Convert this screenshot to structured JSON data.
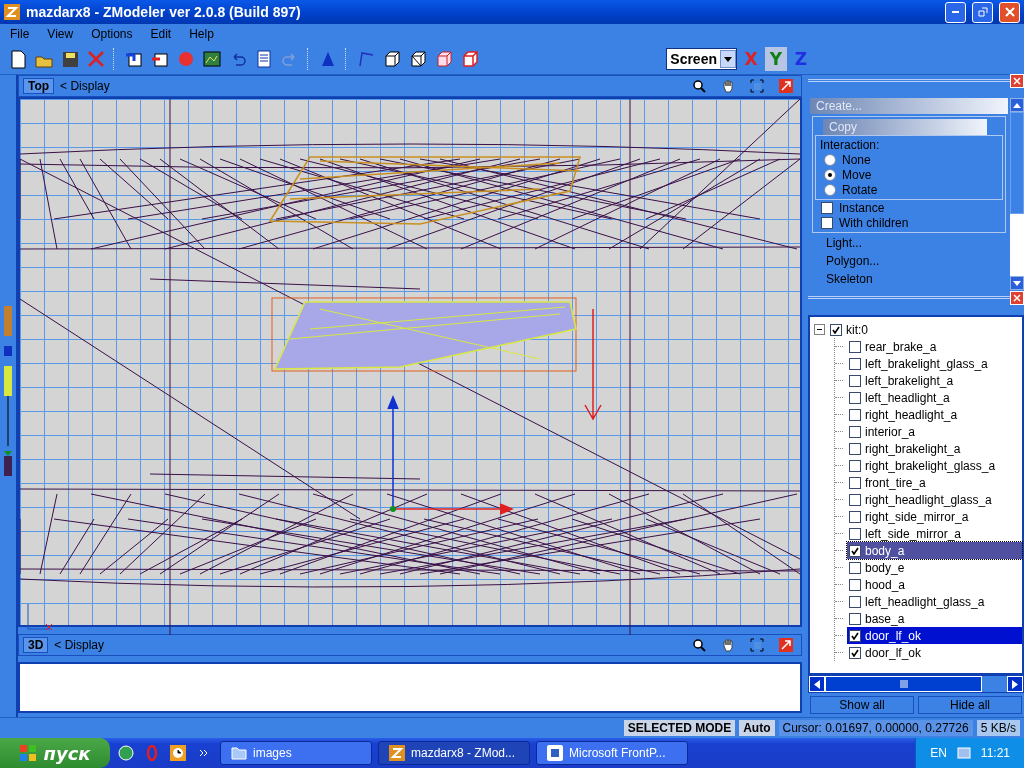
{
  "window": {
    "title": "mazdarx8 - ZModeler ver 2.0.8 (Build 897)"
  },
  "menu": [
    "File",
    "View",
    "Options",
    "Edit",
    "Help"
  ],
  "coord_system": {
    "value": "Screen"
  },
  "axes": [
    {
      "label": "X",
      "selected": false,
      "color": "#e02020"
    },
    {
      "label": "Y",
      "selected": true,
      "color": "#108010"
    },
    {
      "label": "Z",
      "selected": false,
      "color": "#2030e0"
    }
  ],
  "viewports": [
    {
      "name": "Top",
      "display": "< Display"
    },
    {
      "name": "3D",
      "display": "< Display"
    }
  ],
  "command_panel": {
    "create": "Create...",
    "copy": "Copy",
    "interaction": {
      "title": "Interaction:",
      "options": [
        {
          "label": "None",
          "selected": false
        },
        {
          "label": "Move",
          "selected": true
        },
        {
          "label": "Rotate",
          "selected": false
        }
      ]
    },
    "checkboxes": [
      {
        "label": "Instance",
        "checked": false
      },
      {
        "label": "With children",
        "checked": false
      }
    ],
    "links": [
      "Light...",
      "Polygon...",
      "Skeleton"
    ]
  },
  "tree": [
    {
      "label": "kit:0",
      "checked": true,
      "expanded": true,
      "selected": false,
      "focused": false,
      "children": [
        {
          "label": "rear_brake_a",
          "checked": false,
          "selected": false,
          "focused": false
        },
        {
          "label": "left_brakelight_glass_a",
          "checked": false,
          "selected": false,
          "focused": false
        },
        {
          "label": "left_brakelight_a",
          "checked": false,
          "selected": false,
          "focused": false
        },
        {
          "label": "left_headlight_a",
          "checked": false,
          "selected": false,
          "focused": false
        },
        {
          "label": "right_headlight_a",
          "checked": false,
          "selected": false,
          "focused": false
        },
        {
          "label": "interior_a",
          "checked": false,
          "selected": false,
          "focused": false
        },
        {
          "label": "right_brakelight_a",
          "checked": false,
          "selected": false,
          "focused": false
        },
        {
          "label": "right_brakelight_glass_a",
          "checked": false,
          "selected": false,
          "focused": false
        },
        {
          "label": "front_tire_a",
          "checked": false,
          "selected": false,
          "focused": false
        },
        {
          "label": "right_headlight_glass_a",
          "checked": false,
          "selected": false,
          "focused": false
        },
        {
          "label": "right_side_mirror_a",
          "checked": false,
          "selected": false,
          "focused": false
        },
        {
          "label": "left_side_mirror_a",
          "checked": false,
          "selected": false,
          "focused": false
        },
        {
          "label": "body_a",
          "checked": true,
          "selected": true,
          "focused": true
        },
        {
          "label": "body_e",
          "checked": false,
          "selected": false,
          "focused": false
        },
        {
          "label": "hood_a",
          "checked": false,
          "selected": false,
          "focused": false
        },
        {
          "label": "left_headlight_glass_a",
          "checked": false,
          "selected": false,
          "focused": false
        },
        {
          "label": "base_a",
          "checked": false,
          "selected": false,
          "focused": false
        },
        {
          "label": "door_lf_ok",
          "checked": true,
          "selected": true,
          "focused": false
        },
        {
          "label": "door_lf_ok",
          "checked": true,
          "selected": false,
          "focused": false
        }
      ]
    }
  ],
  "tree_buttons": [
    "Show all",
    "Hide all"
  ],
  "status_bar": {
    "mode": "SELECTED MODE",
    "snap": "Auto",
    "cursor": "Cursor: 0.01697, 0.00000, 0.27726",
    "network": "5 KB/s"
  },
  "taskbar": {
    "start": "пуск",
    "tasks": [
      {
        "label": "images",
        "selected": false,
        "kind": "folder"
      },
      {
        "label": "mazdarx8 - ZMod...",
        "selected": true,
        "kind": "zmodeler"
      },
      {
        "label": "Microsoft FrontP...",
        "selected": false,
        "kind": "frontpage"
      }
    ],
    "language": "EN",
    "clock": "11:21"
  }
}
